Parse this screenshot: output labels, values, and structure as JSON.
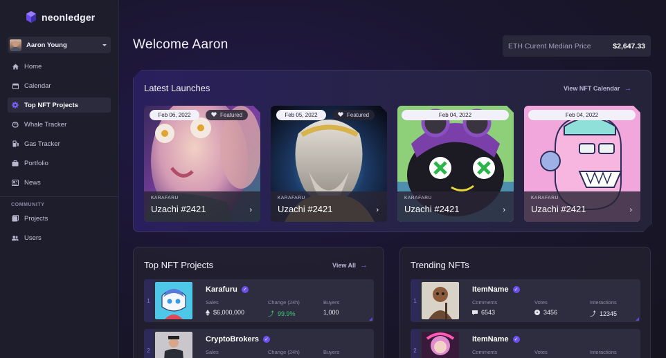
{
  "brand": {
    "name": "neonledger"
  },
  "user": {
    "name": "Aaron Young"
  },
  "nav": {
    "items": [
      {
        "label": "Home",
        "icon": "home-icon"
      },
      {
        "label": "Calendar",
        "icon": "calendar-icon"
      },
      {
        "label": "Top NFT Projects",
        "icon": "gear-icon",
        "active": true
      },
      {
        "label": "Whale Tracker",
        "icon": "whale-icon"
      },
      {
        "label": "Gas Tracker",
        "icon": "gas-pump-icon"
      },
      {
        "label": "Portfolio",
        "icon": "briefcase-icon"
      },
      {
        "label": "News",
        "icon": "newspaper-icon"
      }
    ],
    "community_label": "COMMUNITY",
    "community_items": [
      {
        "label": "Projects",
        "icon": "stack-icon"
      },
      {
        "label": "Users",
        "icon": "users-icon"
      }
    ]
  },
  "header": {
    "welcome": "Welcome Aaron",
    "eth_label": "ETH Curent Median Price",
    "eth_value": "$2,647.33"
  },
  "launches": {
    "title": "Latest Launches",
    "link": "View NFT Calendar",
    "cards": [
      {
        "date": "Feb 06, 2022",
        "featured": "Featured",
        "collection": "KARAFARU",
        "name": "Uzachi #2421"
      },
      {
        "date": "Feb 05, 2022",
        "featured": "Featured",
        "collection": "KARAFARU",
        "name": "Uzachi #2421"
      },
      {
        "date": "Feb 04, 2022",
        "collection": "KARAFARU",
        "name": "Uzachi #2421"
      },
      {
        "date": "Feb 04, 2022",
        "collection": "KARAFARU",
        "name": "Uzachi #2421"
      }
    ]
  },
  "top_projects": {
    "title": "Top NFT Projects",
    "link": "View All",
    "columns": {
      "sales": "Sales",
      "change": "Change (24h)",
      "buyers": "Buyers"
    },
    "rows": [
      {
        "rank": "1",
        "name": "Karafuru",
        "sales": "$6,000,000",
        "change": "99.9%",
        "buyers": "1,000"
      },
      {
        "rank": "2",
        "name": "CryptoBrokers",
        "sales": "",
        "change": "",
        "buyers": ""
      }
    ]
  },
  "trending": {
    "title": "Trending NFTs",
    "columns": {
      "comments": "Comments",
      "votes": "Votes",
      "interactions": "Interactions"
    },
    "rows": [
      {
        "rank": "1",
        "name": "ItemName",
        "comments": "6543",
        "votes": "3456",
        "interactions": "12345"
      },
      {
        "rank": "2",
        "name": "ItemName",
        "comments": "",
        "votes": "",
        "interactions": ""
      }
    ]
  },
  "colors": {
    "accent": "#6c4ff0",
    "positive": "#3fd07a",
    "sidebar": "#1e1d2c"
  }
}
